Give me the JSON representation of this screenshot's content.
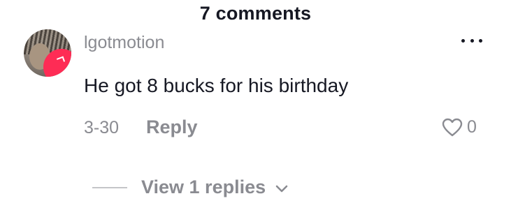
{
  "header": {
    "title": "7 comments"
  },
  "comment": {
    "username": "lgotmotion",
    "text": "He got 8 bucks for his birthday",
    "date": "3-30",
    "reply_label": "Reply",
    "like_count": "0",
    "avatar_icon": "user-avatar-photo",
    "more_icon": "more-horizontal-icon",
    "like_icon": "heart-outline-icon"
  },
  "replies": {
    "view_label": "View 1 replies",
    "chevron_icon": "chevron-down-icon"
  },
  "colors": {
    "primary_text": "#161823",
    "secondary_text": "#8a8b91",
    "accent": "#fe2c55"
  }
}
